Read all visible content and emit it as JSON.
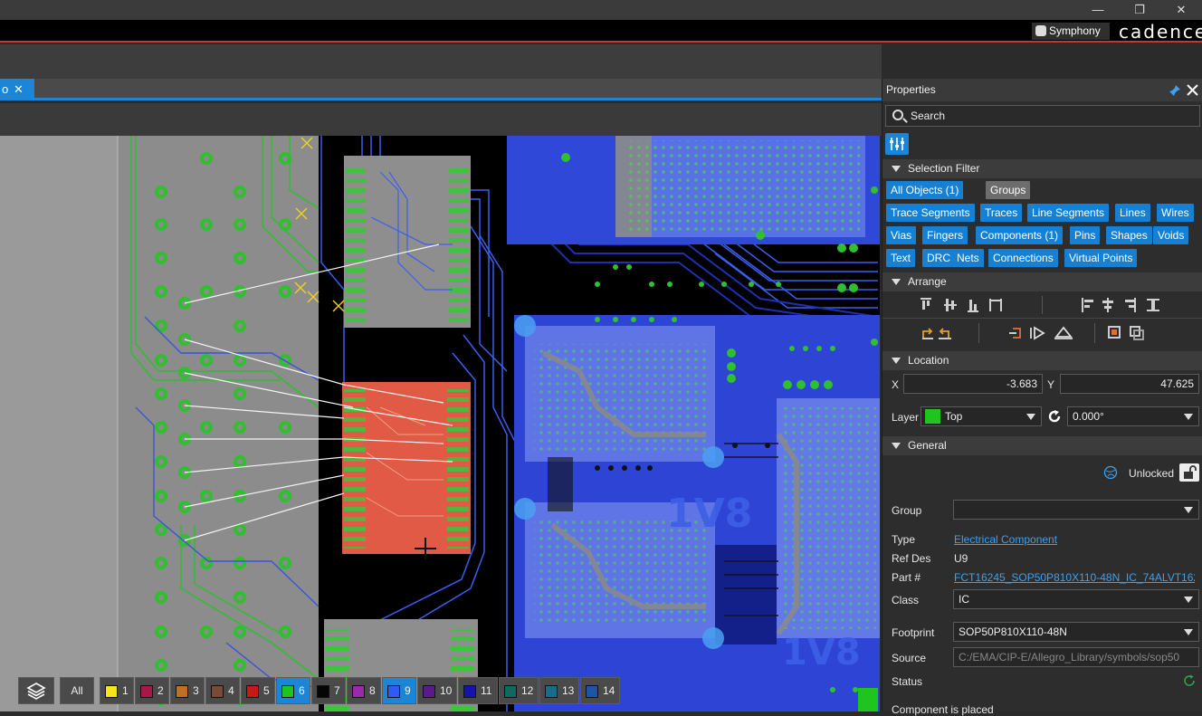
{
  "window": {
    "minimize": "—",
    "restore": "❐",
    "close": "✕"
  },
  "brand": {
    "symphony_label": "Symphony",
    "logo_text": "cadence"
  },
  "document_tab": {
    "label": "o",
    "close": "✕"
  },
  "canvas": {
    "net_labels": [
      "1V8",
      "1V8"
    ]
  },
  "layer_bar": {
    "all_label": "All",
    "layers": [
      {
        "num": "1",
        "color": "#f5e61a",
        "active": false
      },
      {
        "num": "2",
        "color": "#a8174a",
        "active": false
      },
      {
        "num": "3",
        "color": "#c0701e",
        "active": false
      },
      {
        "num": "4",
        "color": "#7a4a36",
        "active": false
      },
      {
        "num": "5",
        "color": "#c81818",
        "active": false
      },
      {
        "num": "6",
        "color": "#1fc41f",
        "active": true
      },
      {
        "num": "7",
        "color": "#050505",
        "active": false
      },
      {
        "num": "8",
        "color": "#9a2aa8",
        "active": false
      },
      {
        "num": "9",
        "color": "#2e5cf0",
        "active": true
      },
      {
        "num": "10",
        "color": "#5a1a8a",
        "active": false
      },
      {
        "num": "11",
        "color": "#1414a8",
        "active": false
      },
      {
        "num": "12",
        "color": "#0f6a5e",
        "active": false
      },
      {
        "num": "13",
        "color": "#166f88",
        "active": false
      },
      {
        "num": "14",
        "color": "#1b56a8",
        "active": false
      }
    ]
  },
  "panel": {
    "title": "Properties",
    "search_placeholder": "Search",
    "selection_filter": {
      "heading": "Selection Filter",
      "chips": [
        {
          "label": "All Objects (1)",
          "selected": true
        },
        {
          "label": "Groups",
          "selected": false
        },
        {
          "label": "Trace Segments",
          "selected": true
        },
        {
          "label": "Traces",
          "selected": true
        },
        {
          "label": "Line Segments",
          "selected": true
        },
        {
          "label": "Lines",
          "selected": true
        },
        {
          "label": "Wires",
          "selected": true
        },
        {
          "label": "Vias",
          "selected": true
        },
        {
          "label": "Fingers",
          "selected": true
        },
        {
          "label": "Components (1)",
          "selected": true
        },
        {
          "label": "Pins",
          "selected": true
        },
        {
          "label": "Shapes",
          "selected": true
        },
        {
          "label": "Voids",
          "selected": true
        },
        {
          "label": "Text",
          "selected": true
        },
        {
          "label": "DRC",
          "selected": true
        },
        {
          "label": "Nets",
          "selected": true
        },
        {
          "label": "Connections",
          "selected": true
        },
        {
          "label": "Virtual Points",
          "selected": true
        }
      ]
    },
    "arrange": {
      "heading": "Arrange"
    },
    "location": {
      "heading": "Location",
      "x_label": "X",
      "x_value": "-3.683",
      "y_label": "Y",
      "y_value": "47.625",
      "layer_label": "Layer",
      "layer_value": "Top",
      "layer_color": "#1fc41f",
      "rotation_value": "0.000°"
    },
    "general": {
      "heading": "General",
      "lock_state": "Unlocked",
      "group_label": "Group",
      "group_value": "",
      "type_label": "Type",
      "type_value": "Electrical Component",
      "refdes_label": "Ref Des",
      "refdes_value": "U9",
      "part_label": "Part #",
      "part_value": "FCT16245_SOP50P810X110-48N_IC_74ALVT16245...",
      "class_label": "Class",
      "class_value": "IC",
      "footprint_label": "Footprint",
      "footprint_value": "SOP50P810X110-48N",
      "source_label": "Source",
      "source_value": "C:/EMA/CIP-E/Allegro_Library/symbols/sop50",
      "status_label": "Status",
      "status_text": "Component is placed"
    }
  }
}
